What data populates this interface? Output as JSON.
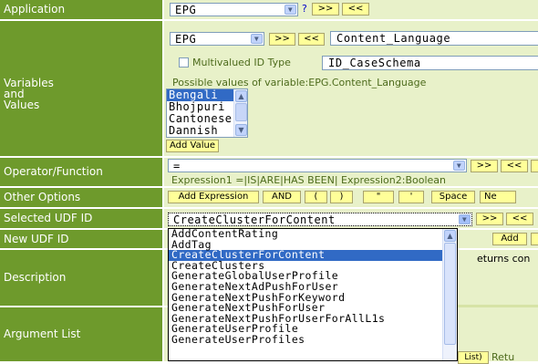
{
  "rows": {
    "application": "Application",
    "variables": [
      "Variables",
      "and",
      "Values"
    ],
    "operator": "Operator/Function",
    "other_options": "Other Options",
    "selected_udf": "Selected UDF ID",
    "new_udf": "New UDF ID",
    "description": "Description",
    "argument_list": "Argument List"
  },
  "application": {
    "selected": "EPG",
    "help": "?",
    "btn_next": ">>",
    "btn_prev": "<<"
  },
  "variables": {
    "app_select": "EPG",
    "btn_next": ">>",
    "btn_prev": "<<",
    "variable_select": "Content_Language",
    "multivalued_label": "Multivalued ID Type",
    "id_type_value": "ID_CaseSchema",
    "possible_values_label": "Possible values of variable:EPG.Content_Language",
    "values": [
      "Bengali",
      "Bhojpuri",
      "Cantonese",
      "Dannish"
    ],
    "selected_value": "Bengali",
    "add_value_button": "Add Value"
  },
  "operator": {
    "selected": "=",
    "btn_next": ">>",
    "btn_prev": "<<",
    "btn_partial": "(",
    "hint": "Expression1 =|IS|ARE|HAS BEEN| Expression2:Boolean"
  },
  "other_options": {
    "buttons": [
      "Add Expression",
      "AND",
      "(",
      ")",
      "\"",
      "'",
      "Space",
      "Ne"
    ]
  },
  "selected_udf": {
    "selected": "CreateClusterForContent",
    "btn_next": ">>",
    "btn_prev": "<<"
  },
  "new_udf": {
    "add_button": "Add"
  },
  "description": {
    "partial_text": "eturns con"
  },
  "argument_list": {
    "partial_button": "List)",
    "partial_text": "Retu"
  },
  "udf_dropdown": {
    "options": [
      "AddContentRating",
      "AddTag",
      "CreateClusterForContent",
      "CreateClusters",
      "GenerateGlobalUserProfile",
      "GenerateNextAdPushForUser",
      "GenerateNextPushForKeyword",
      "GenerateNextPushForUser",
      "GenerateNextPushForUserForAllL1s",
      "GenerateUserProfile",
      "GenerateUserProfiles"
    ],
    "selected": "CreateClusterForContent"
  },
  "colors": {
    "label_bg": "#6e9a2c",
    "value_bg": "#e8f1c9",
    "button_bg": "#ffff99",
    "selection": "#316ac5"
  }
}
